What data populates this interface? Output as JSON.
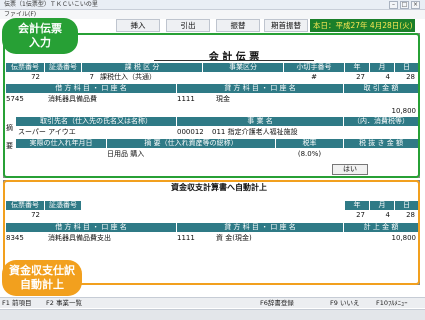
{
  "window": {
    "title": "伝票（1伝票型）ＴＫＣいこいの里"
  },
  "menu": {
    "label": "ファイル(F)"
  },
  "toolbar": {
    "buttons": [
      "挿入",
      "引出",
      "振替",
      "期首振替"
    ],
    "date": "本日：平成27年 4月28日(火)"
  },
  "callouts": {
    "top_line1": "会計伝票",
    "top_line2": "入力",
    "bottom_line1": "資金収支仕訳",
    "bottom_line2": "自動計上"
  },
  "voucher": {
    "title": "会 計 伝 票",
    "head_labels": [
      "伝票番号",
      "証憑番号",
      "課 税 区 分",
      "事業区分",
      "小切手番号",
      "年",
      "月",
      "日"
    ],
    "head_values": {
      "voucher_no": "72",
      "tax_code": "7",
      "tax_name": "課税仕入（共通）",
      "check_no": "#",
      "year": "27",
      "month": "4",
      "day": "28"
    },
    "acct_labels": [
      "借 方 科 目 ・ 口 座 名",
      "貸 方 科 目 ・ 口 座 名",
      "取 引 金 額"
    ],
    "debit_code": "5745",
    "debit_name": "消耗器具備品費",
    "credit_code": "1111",
    "credit_name": "現金",
    "amount": "10,800",
    "side_label": "摘\n\n要",
    "trade_label": "取引先名（仕入先の氏名又は名称）",
    "biz_label": "事 業 名",
    "tax_included_label": "（内．消費税等）",
    "partner": "スーパー アイウエ",
    "biz_code": "000012",
    "biz_name": "011 指定介護老人福祉施設",
    "date_hdr": "実際の仕入れ年月日",
    "summary_hdr": "摘 要（仕入れ資産等の総称）",
    "rate_hdr": "税率",
    "taxless_hdr": "税 抜 き 金 額",
    "summary": "日用品 購入",
    "rate": "(8.0%)",
    "ok_button": "はい"
  },
  "fund": {
    "title": "資金収支計算書へ自動計上",
    "head_labels": [
      "伝票番号",
      "証憑番号",
      "年",
      "月",
      "日"
    ],
    "voucher_no": "72",
    "year": "27",
    "month": "4",
    "day": "28",
    "acct_labels": [
      "借 方 科 目 ・ 口 座 名",
      "貸 方 科 目 ・ 口 座 名",
      "計 上 金 額"
    ],
    "debit_code": "8345",
    "debit_name": "消耗器具備品費支出",
    "credit_code": "1111",
    "credit_name": "資 金(現金)",
    "amount": "10,800"
  },
  "fkeys": [
    "F1 前項目",
    "F2 事業一覧",
    "F6辞書登録",
    "F9 いいえ",
    "F10ﾌﾙﾒﾆｭｰ"
  ]
}
